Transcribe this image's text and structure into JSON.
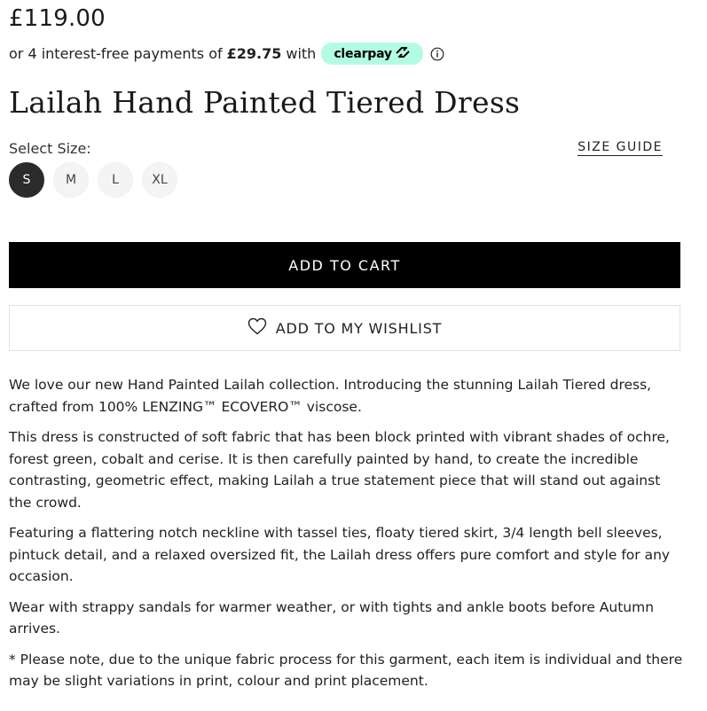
{
  "product": {
    "price": "£119.00",
    "installment_prefix": "or 4 interest-free payments of",
    "installment_amount": "£29.75",
    "installment_suffix": "with",
    "clearpay_label": "clearpay",
    "title": "Lailah Hand Painted Tiered Dress"
  },
  "size": {
    "label": "Select Size:",
    "guide_label": "SIZE GUIDE",
    "options": [
      "S",
      "M",
      "L",
      "XL"
    ],
    "selected": "S"
  },
  "actions": {
    "add_to_cart": "ADD TO CART",
    "wishlist": "ADD TO MY WISHLIST"
  },
  "description": [
    "We love our new Hand Painted Lailah collection. Introducing the stunning Lailah Tiered dress, crafted from 100% LENZING™ ECOVERO™ viscose.",
    "This dress is constructed of soft fabric that has been block printed with vibrant shades of ochre, forest green, cobalt and cerise. It is then carefully painted by hand, to create the incredible contrasting, geometric effect, making Lailah a true statement piece that will stand out against the crowd.",
    "Featuring a flattering notch neckline with tassel ties, floaty tiered skirt, 3/4 length bell sleeves, pintuck detail, and a relaxed oversized fit, the Lailah dress offers pure comfort and style for any occasion.",
    "Wear with strappy sandals for warmer weather, or with tights and ankle boots before Autumn arrives.",
    "* Please note, due to the unique fabric process for this garment, each item is individual and there may be slight variations in print, colour and print placement."
  ],
  "colors": {
    "clearpay_mint": "#b2fce4",
    "selected_size": "#2b2b2b",
    "cart_button": "#000000"
  },
  "icons": {
    "clearpay_logo": "clearpay-arrows-icon",
    "info": "info-icon",
    "wishlist": "heart-icon"
  }
}
